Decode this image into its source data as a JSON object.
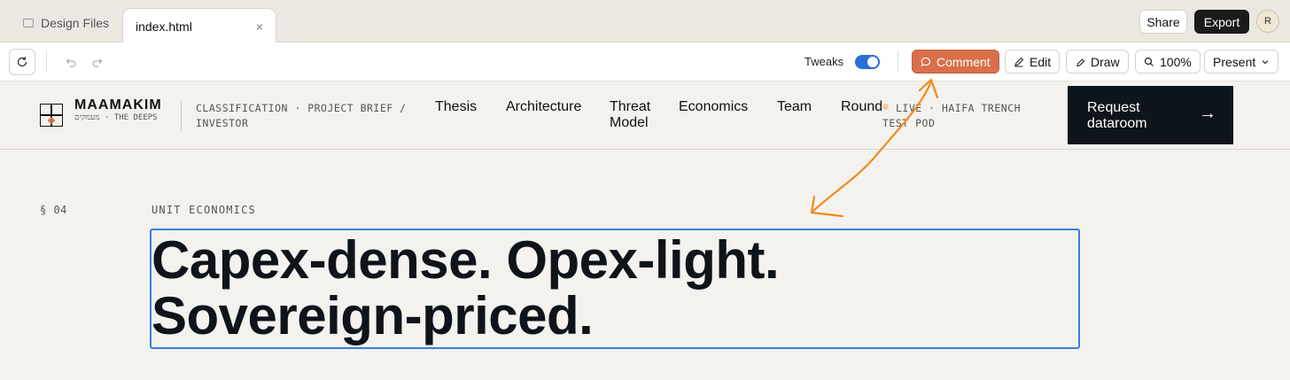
{
  "tabs": {
    "files_label": "Design Files",
    "active_label": "index.html",
    "close_glyph": "×"
  },
  "window_actions": {
    "share_label": "Share",
    "export_label": "Export",
    "avatar_initial": "R"
  },
  "toolbar": {
    "tweaks_label": "Tweaks",
    "tweaks_on": true,
    "comment_label": "Comment",
    "edit_label": "Edit",
    "draw_label": "Draw",
    "zoom_label": "100%",
    "present_label": "Present"
  },
  "site": {
    "brand": "MAAMAKIM",
    "brand_sub": "מעמקים · THE DEEPS",
    "classification": "CLASSIFICATION · PROJECT BRIEF / INVESTOR",
    "nav": [
      "Thesis",
      "Architecture",
      "Threat Model",
      "Economics",
      "Team",
      "Round"
    ],
    "live_status": "LIVE · HAIFA TRENCH TEST POD",
    "cta_label": "Request dataroom",
    "cta_arrow": "→"
  },
  "main": {
    "section_number": "§ 04",
    "eyebrow": "UNIT ECONOMICS",
    "headline_line1": "Capex-dense. Opex-light.",
    "headline_line2": "Sovereign-priced."
  },
  "colors": {
    "accent": "#d9704a",
    "selection": "#3a7de0",
    "annotation": "#f08a1c",
    "cta_bg": "#0e141b"
  }
}
